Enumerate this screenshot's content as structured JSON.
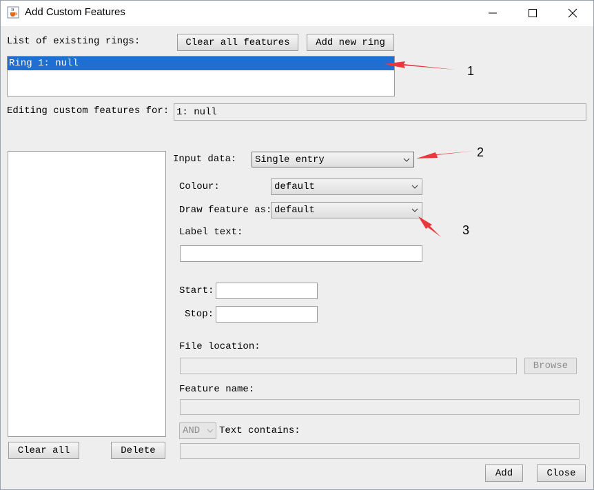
{
  "window": {
    "title": "Add Custom Features",
    "icon": "java-cup-icon",
    "controls": {
      "minimize": "minimize-icon",
      "maximize": "maximize-icon",
      "close": "close-icon"
    }
  },
  "rings": {
    "label": "List of existing rings:",
    "clear_all_features": "Clear all features",
    "add_new_ring": "Add new ring",
    "items": [
      "Ring 1: null"
    ],
    "selected": 0
  },
  "editing": {
    "label": "Editing custom features for:",
    "value": "1: null"
  },
  "features_panel": {
    "clear_all": "Clear all",
    "delete": "Delete"
  },
  "form": {
    "input_data_label": "Input data:",
    "input_data_value": "Single entry",
    "colour_label": "Colour:",
    "colour_value": "default",
    "draw_label": "Draw feature as:",
    "draw_value": "default",
    "label_text_label": "Label text:",
    "label_text_value": "",
    "start_label": "Start:",
    "start_value": "",
    "stop_label": "Stop:",
    "stop_value": "",
    "file_location_label": "File location:",
    "file_location_value": "",
    "browse": "Browse",
    "feature_name_label": "Feature name:",
    "feature_name_value": "",
    "operator_value": "AND",
    "text_contains_label": "Text contains:",
    "text_contains_value": ""
  },
  "actions": {
    "add": "Add",
    "close": "Close"
  },
  "annotations": [
    "1",
    "2",
    "3"
  ],
  "colors": {
    "selection": "#1f6fd2",
    "arrow": "#e8383d",
    "panel": "#eeeeee"
  }
}
